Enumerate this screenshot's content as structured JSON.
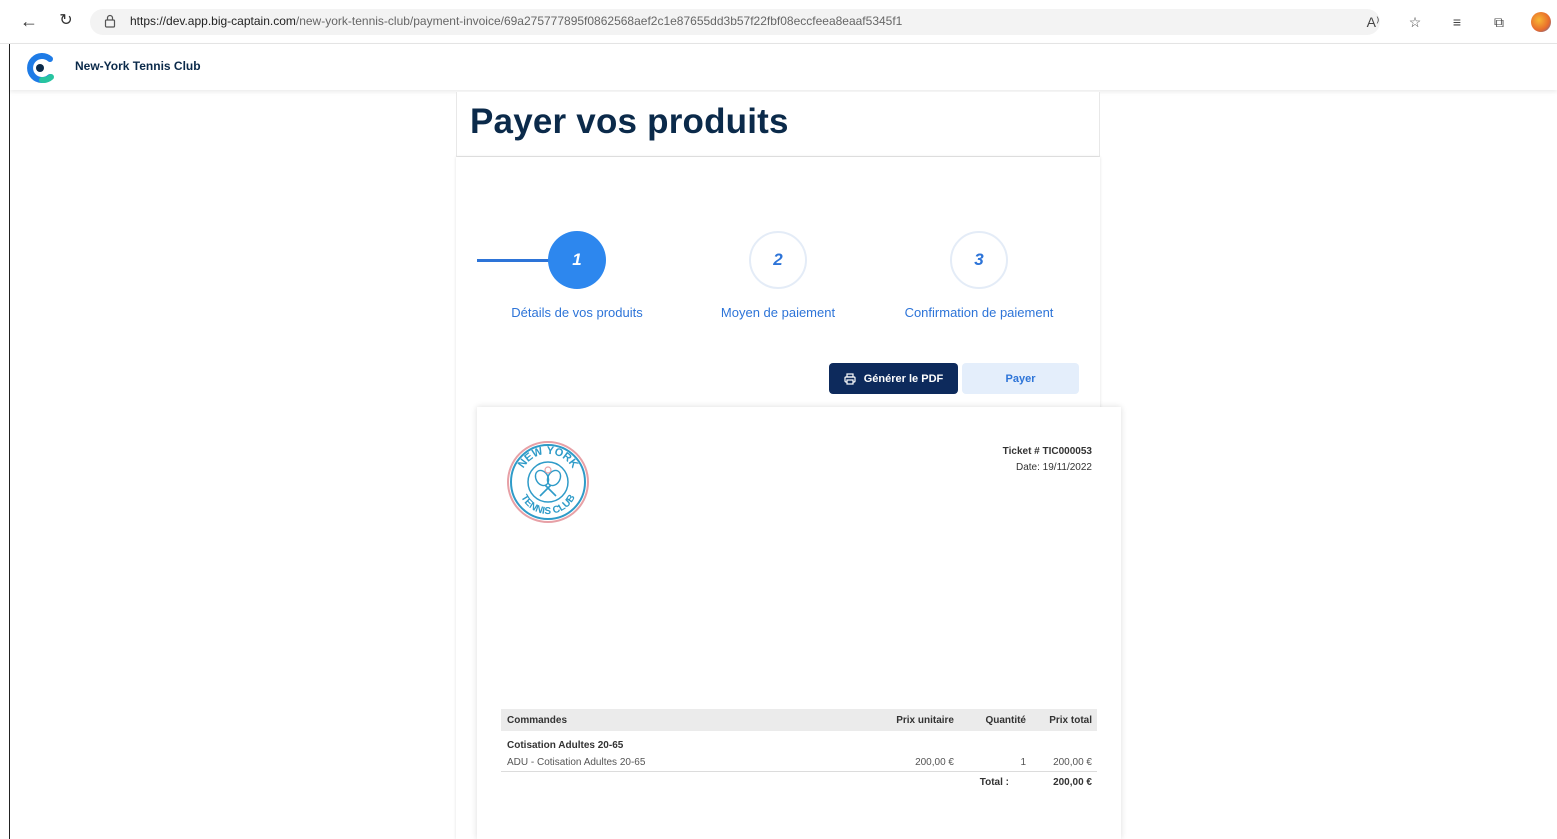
{
  "browser": {
    "url_host": "https://dev.app.big-captain.com",
    "url_path": "/new-york-tennis-club/payment-invoice/69a275777895f0862568aef2c1e87655dd3b57f22fbf08eccfeea8eaaf5345f1",
    "read_aloud_label": "A⁾"
  },
  "header": {
    "brand_name": "New-York Tennis Club"
  },
  "page": {
    "title": "Payer vos produits"
  },
  "stepper": {
    "steps": [
      {
        "number": "1",
        "label": "Détails de vos produits",
        "active": true
      },
      {
        "number": "2",
        "label": "Moyen de paiement",
        "active": false
      },
      {
        "number": "3",
        "label": "Confirmation de paiement",
        "active": false
      }
    ]
  },
  "actions": {
    "pdf_label": "Générer le PDF",
    "pay_label": "Payer"
  },
  "invoice": {
    "logo_text_top": "NEW YORK",
    "logo_text_bottom": "TENNIS CLUB",
    "ticket": "Ticket # TIC000053",
    "date": "Date: 19/11/2022",
    "columns": [
      "Commandes",
      "Prix unitaire",
      "Quantité",
      "Prix total"
    ],
    "group_title": "Cotisation Adultes 20-65",
    "rows": [
      {
        "item": "ADU - Cotisation Adultes 20-65",
        "unit_price": "200,00 €",
        "quantity": "1",
        "total": "200,00 €"
      }
    ],
    "total_label": "Total :",
    "total_value": "200,00 €"
  },
  "colors": {
    "primary": "#2d87ee",
    "navy": "#0d2a5c",
    "title": "#0b2a4a",
    "pay_bg": "#e4eefb"
  }
}
